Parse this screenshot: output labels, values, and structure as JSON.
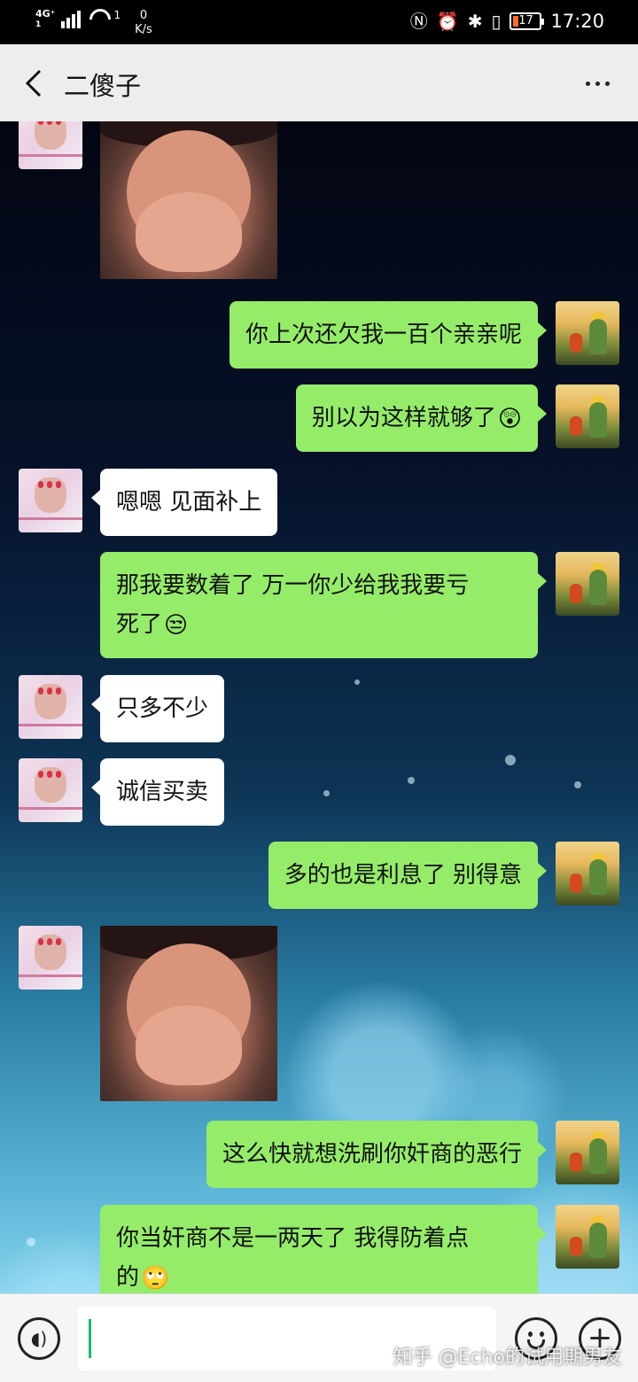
{
  "status_bar": {
    "network_type": "4G⁺",
    "sim_count": "1",
    "wifi_count": "1",
    "speed_value": "0",
    "speed_unit": "K/s",
    "battery_level": "17",
    "time": "17:20",
    "icons": [
      "signal-icon",
      "wifi-icon",
      "nfc-icon",
      "alarm-icon",
      "bluetooth-icon",
      "vibrate-icon",
      "battery-icon"
    ]
  },
  "header": {
    "title": "二傻子",
    "back_icon": "chevron-left-icon",
    "more_icon": "more-dots-icon"
  },
  "messages": [
    {
      "side": "left",
      "type": "image",
      "content": "heart-hands-photo"
    },
    {
      "side": "right",
      "type": "text",
      "text": "你上次还欠我一百个亲亲呢"
    },
    {
      "side": "right",
      "type": "text",
      "text": "别以为这样就够了",
      "emoji": "😲"
    },
    {
      "side": "left",
      "type": "text",
      "text": "嗯嗯 见面补上"
    },
    {
      "side": "right",
      "type": "text",
      "line1": "那我要数着了 万一你少给我我要亏",
      "line2": "死了",
      "emoji": "😒"
    },
    {
      "side": "left",
      "type": "text",
      "text": "只多不少"
    },
    {
      "side": "left",
      "type": "text",
      "text": "诚信买卖"
    },
    {
      "side": "right",
      "type": "text",
      "text": "多的也是利息了 别得意"
    },
    {
      "side": "left",
      "type": "image",
      "content": "heart-hands-photo"
    },
    {
      "side": "right",
      "type": "text",
      "text": "这么快就想洗刷你奸商的恶行"
    },
    {
      "side": "right",
      "type": "text",
      "line1": "你当奸商不是一两天了 我得防着点",
      "line2": "的",
      "emoji": "🙄"
    }
  ],
  "input_bar": {
    "input_value": "",
    "voice_icon": "voice-icon",
    "emoji_icon": "emoji-icon",
    "plus_icon": "plus-icon"
  },
  "watermark": "知乎 @Echo的试用期男友",
  "colors": {
    "self_bubble": "#95ec69",
    "other_bubble": "#ffffff",
    "header_bg": "#ededed",
    "caret": "#07c160"
  }
}
